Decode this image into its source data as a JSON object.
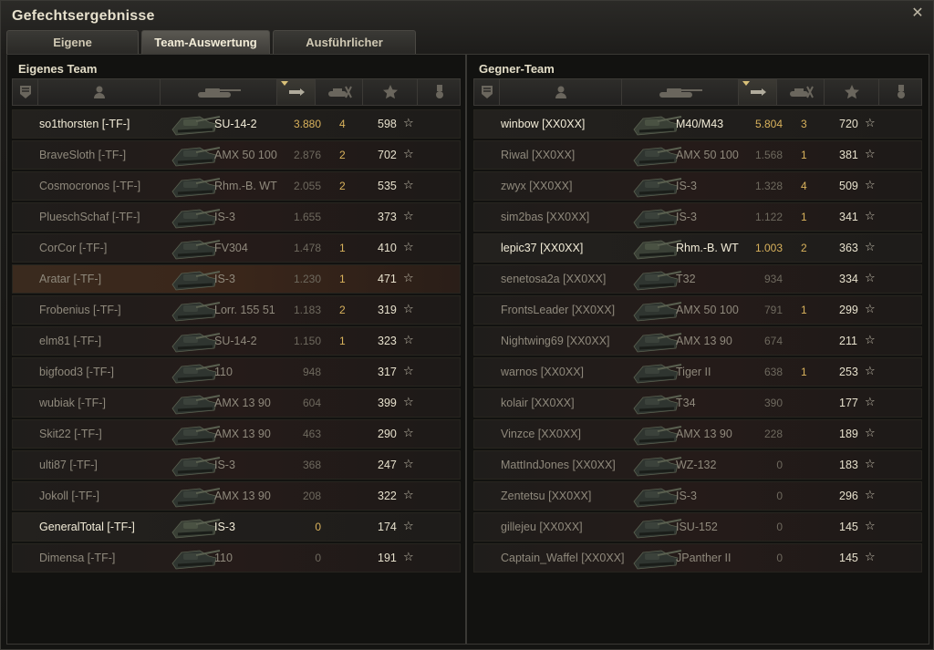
{
  "window": {
    "title": "Gefechtsergebnisse"
  },
  "tabs": [
    {
      "label": "Eigene Auswertung"
    },
    {
      "label": "Team-Auswertung"
    },
    {
      "label": "Ausführlicher Bericht"
    }
  ],
  "own_team": {
    "title": "Eigenes Team",
    "rows": [
      {
        "name": "so1thorsten [-TF-]",
        "vehicle": "SU-14-2",
        "damage": "3.880",
        "kills": "4",
        "xp": "598",
        "style": "bright"
      },
      {
        "name": "BraveSloth [-TF-]",
        "vehicle": "AMX 50 100",
        "damage": "2.876",
        "kills": "2",
        "xp": "702",
        "style": "dim"
      },
      {
        "name": "Cosmocronos [-TF-]",
        "vehicle": "Rhm.-B. WT",
        "damage": "2.055",
        "kills": "2",
        "xp": "535",
        "style": "dim"
      },
      {
        "name": "PlueschSchaf [-TF-]",
        "vehicle": "IS-3",
        "damage": "1.655",
        "kills": "",
        "xp": "373",
        "style": "dim"
      },
      {
        "name": "CorCor [-TF-]",
        "vehicle": "FV304",
        "damage": "1.478",
        "kills": "1",
        "xp": "410",
        "style": "dim"
      },
      {
        "name": "Aratar [-TF-]",
        "vehicle": "IS-3",
        "damage": "1.230",
        "kills": "1",
        "xp": "471",
        "style": "hl"
      },
      {
        "name": "Frobenius [-TF-]",
        "vehicle": "Lorr. 155 51",
        "damage": "1.183",
        "kills": "2",
        "xp": "319",
        "style": "dim"
      },
      {
        "name": "elm81 [-TF-]",
        "vehicle": "SU-14-2",
        "damage": "1.150",
        "kills": "1",
        "xp": "323",
        "style": "dim"
      },
      {
        "name": "bigfood3 [-TF-]",
        "vehicle": "110",
        "damage": "948",
        "kills": "",
        "xp": "317",
        "style": "dim"
      },
      {
        "name": "wubiak [-TF-]",
        "vehicle": "AMX 13 90",
        "damage": "604",
        "kills": "",
        "xp": "399",
        "style": "dim"
      },
      {
        "name": "Skit22 [-TF-]",
        "vehicle": "AMX 13 90",
        "damage": "463",
        "kills": "",
        "xp": "290",
        "style": "dim"
      },
      {
        "name": "ulti87 [-TF-]",
        "vehicle": "IS-3",
        "damage": "368",
        "kills": "",
        "xp": "247",
        "style": "dim"
      },
      {
        "name": "Jokoll [-TF-]",
        "vehicle": "AMX 13 90",
        "damage": "208",
        "kills": "",
        "xp": "322",
        "style": "dim"
      },
      {
        "name": "GeneralTotal [-TF-]",
        "vehicle": "IS-3",
        "damage": "0",
        "kills": "",
        "xp": "174",
        "style": "bright"
      },
      {
        "name": "Dimensa [-TF-]",
        "vehicle": "110",
        "damage": "0",
        "kills": "",
        "xp": "191",
        "style": "dim"
      }
    ]
  },
  "enemy_team": {
    "title": "Gegner-Team",
    "rows": [
      {
        "name": "winbow [XX0XX]",
        "vehicle": "M40/M43",
        "damage": "5.804",
        "kills": "3",
        "xp": "720",
        "style": "bright"
      },
      {
        "name": "Riwal [XX0XX]",
        "vehicle": "AMX 50 100",
        "damage": "1.568",
        "kills": "1",
        "xp": "381",
        "style": "dim"
      },
      {
        "name": "zwyx [XX0XX]",
        "vehicle": "IS-3",
        "damage": "1.328",
        "kills": "4",
        "xp": "509",
        "style": "dim"
      },
      {
        "name": "sim2bas [XX0XX]",
        "vehicle": "IS-3",
        "damage": "1.122",
        "kills": "1",
        "xp": "341",
        "style": "dim"
      },
      {
        "name": "lepic37 [XX0XX]",
        "vehicle": "Rhm.-B. WT",
        "damage": "1.003",
        "kills": "2",
        "xp": "363",
        "style": "bright"
      },
      {
        "name": "senetosa2a [XX0XX]",
        "vehicle": "T32",
        "damage": "934",
        "kills": "",
        "xp": "334",
        "style": "dim"
      },
      {
        "name": "FrontsLeader [XX0XX]",
        "vehicle": "AMX 50 100",
        "damage": "791",
        "kills": "1",
        "xp": "299",
        "style": "dim"
      },
      {
        "name": "Nightwing69 [XX0XX]",
        "vehicle": "AMX 13 90",
        "damage": "674",
        "kills": "",
        "xp": "211",
        "style": "dim"
      },
      {
        "name": "warnos [XX0XX]",
        "vehicle": "Tiger II",
        "damage": "638",
        "kills": "1",
        "xp": "253",
        "style": "dim"
      },
      {
        "name": "kolair [XX0XX]",
        "vehicle": "T34",
        "damage": "390",
        "kills": "",
        "xp": "177",
        "style": "dim"
      },
      {
        "name": "Vinzce [XX0XX]",
        "vehicle": "AMX 13 90",
        "damage": "228",
        "kills": "",
        "xp": "189",
        "style": "dim"
      },
      {
        "name": "MattIndJones [XX0XX]",
        "vehicle": "WZ-132",
        "damage": "0",
        "kills": "",
        "xp": "183",
        "style": "dim"
      },
      {
        "name": "Zentetsu [XX0XX]",
        "vehicle": "IS-3",
        "damage": "0",
        "kills": "",
        "xp": "296",
        "style": "dim"
      },
      {
        "name": "gillejeu [XX0XX]",
        "vehicle": "ISU-152",
        "damage": "0",
        "kills": "",
        "xp": "145",
        "style": "dim"
      },
      {
        "name": "Captain_Waffel [XX0XX]",
        "vehicle": "JPanther II",
        "damage": "0",
        "kills": "",
        "xp": "145",
        "style": "dim"
      }
    ]
  },
  "icons": {
    "close": "close-icon",
    "columns": [
      "squad-icon",
      "player-icon",
      "tank-icon",
      "damage-icon",
      "kills-icon",
      "xp-star-icon",
      "medal-icon"
    ],
    "star": "☆"
  },
  "colors": {
    "accent": "#d9b25c",
    "bright_text": "#f2ecd8",
    "dim_text": "#8f897c",
    "highlight_row": "#3a2a1e"
  }
}
